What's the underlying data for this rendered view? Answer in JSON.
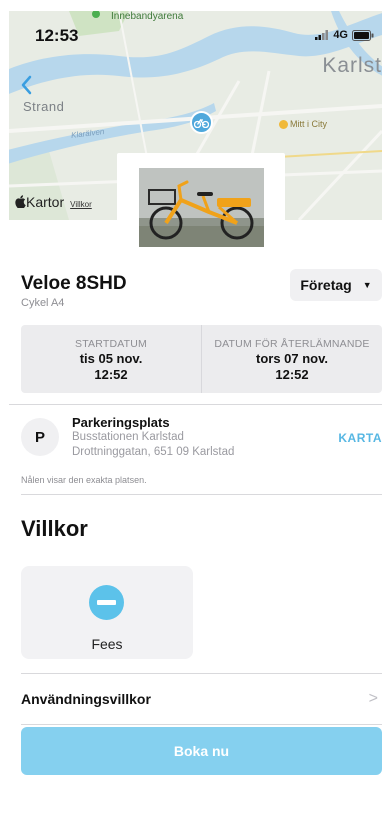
{
  "status_bar": {
    "time": "12:53",
    "network": "4G"
  },
  "map": {
    "labels": {
      "venue": "Innebandyarena",
      "city": "Karlst",
      "district": "Strand",
      "river": "Klarälven",
      "poi": "Mitt i City"
    },
    "attribution": {
      "brand": "Kartor",
      "terms": "Villkor"
    },
    "colors": {
      "water": "#b7d7ec",
      "land": "#e7ece3",
      "park": "#cfe3c3",
      "pin": "#4fa8dc"
    }
  },
  "vehicle": {
    "name": "Veloe 8SHD",
    "subtitle": "Cykel A4",
    "account_selector": "Företag"
  },
  "dates": {
    "start": {
      "label": "STARTDATUM",
      "day": "tis 05 nov.",
      "time": "12:52"
    },
    "return": {
      "label": "DATUM FÖR ÅTERLÄMNANDE",
      "day": "tors 07 nov.",
      "time": "12:52"
    }
  },
  "parking": {
    "badge": "P",
    "title": "Parkeringsplats",
    "line1": "Busstationen Karlstad",
    "line2": "Drottninggatan, 651 09 Karlstad",
    "map_link": "KARTA",
    "note": "Nålen visar den exakta platsen."
  },
  "terms": {
    "heading": "Villkor",
    "fees_label": "Fees",
    "usage_terms": "Användningsvillkor"
  },
  "actions": {
    "book": "Boka nu"
  },
  "colors": {
    "accent": "#57b7e3",
    "button": "#85d0ef",
    "panel": "#ececee"
  }
}
